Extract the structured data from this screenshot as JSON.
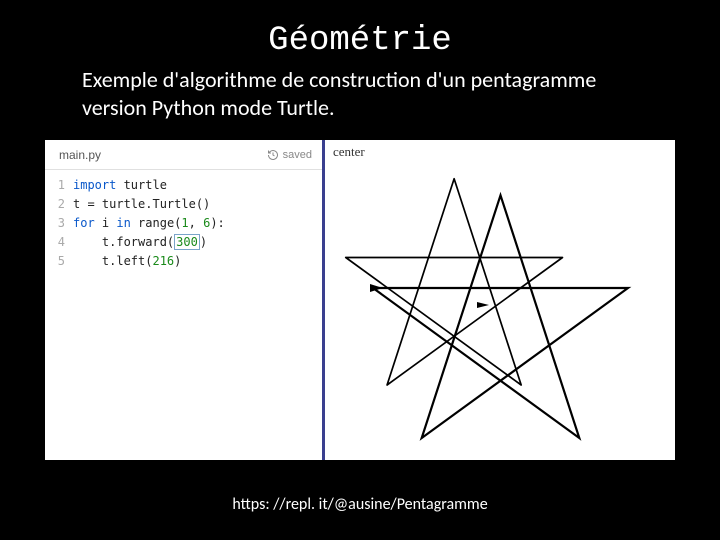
{
  "title": "Géométrie",
  "subtitle": "Exemple d'algorithme de construction d'un pentagramme version Python mode Turtle.",
  "ide": {
    "filename": "main.py",
    "saved_label": "saved",
    "output_label": "center",
    "gutter": [
      "1",
      "2",
      "3",
      "4",
      "5"
    ],
    "code": {
      "l1_import": "import",
      "l1_mod": " turtle",
      "l2": "t = turtle.Turtle()",
      "l3_for": "for",
      "l3_rest1": " i ",
      "l3_in": "in",
      "l3_rest2": " range(",
      "l3_n1": "1",
      "l3_comma": ", ",
      "l3_n2": "6",
      "l3_close": "):",
      "l4_pre": "    t.forward(",
      "l4_n": "300",
      "l4_post": ")",
      "l5_pre": "    t.left(",
      "l5_n": "216",
      "l5_post": ")"
    }
  },
  "footer_url": "https: //repl. it/@ausine/Pentagramme"
}
